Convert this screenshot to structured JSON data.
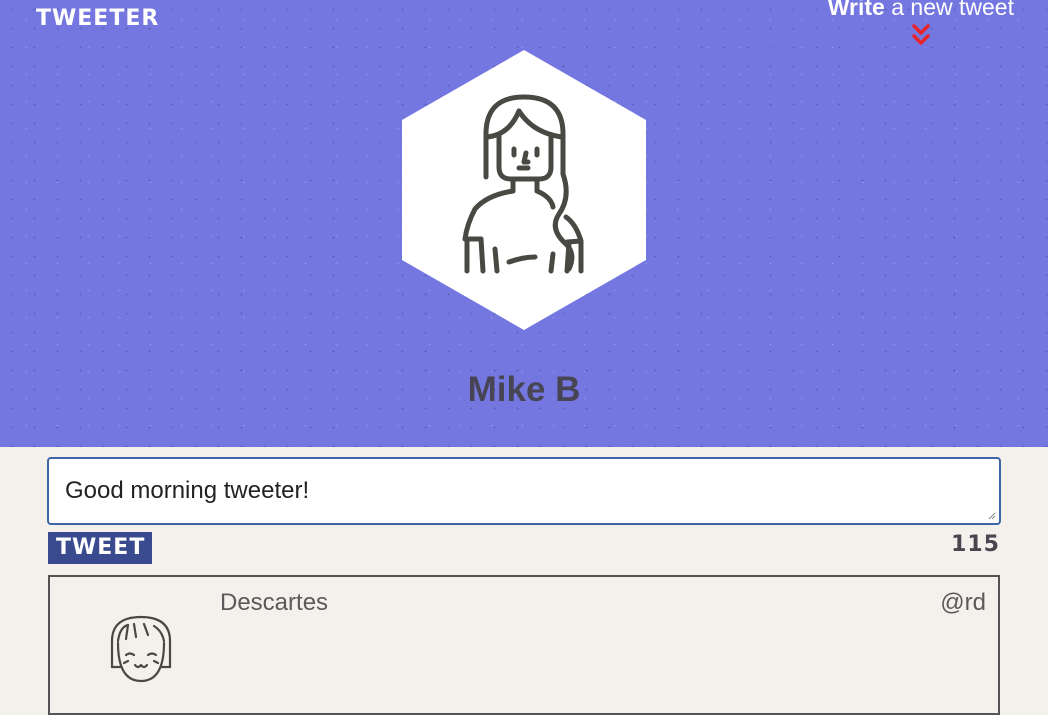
{
  "app": {
    "logo": "TWEETER"
  },
  "header": {
    "compose_strong": "Write",
    "compose_rest": " a new tweet",
    "compose_icon": "double-chevron-down-icon",
    "profile_name": "Mike B",
    "avatar_icon": "woman-avatar-icon"
  },
  "composer": {
    "text": "Good morning tweeter!",
    "button_label": "TWEET",
    "char_count": "115"
  },
  "tweets": [
    {
      "name": "Descartes",
      "handle": "@rd",
      "avatar_icon": "girl-avatar-icon"
    }
  ],
  "colors": {
    "header_bg": "#7577e0",
    "page_bg": "#f4f1ec",
    "button_bg": "#3a4a8e",
    "chevron": "#e8242b",
    "composer_border": "#3e64a8"
  }
}
